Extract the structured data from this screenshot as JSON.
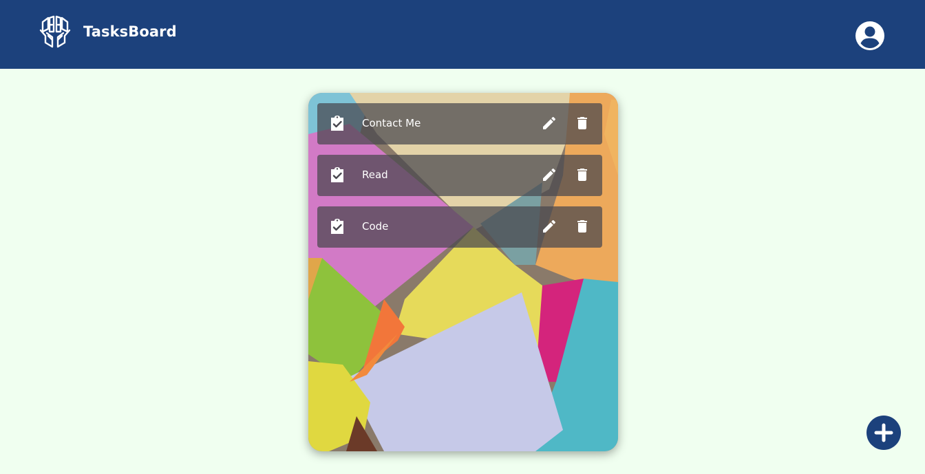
{
  "app": {
    "name": "TasksBoard",
    "logo_icon": "hands-brain-logo-icon"
  },
  "header": {
    "account_icon": "account-circle-icon",
    "background": "#1c417c"
  },
  "board": {
    "background_icon": "sticky-notes-photo",
    "tasks": [
      {
        "label": "Contact Me"
      },
      {
        "label": "Read"
      },
      {
        "label": "Code"
      }
    ]
  },
  "fab": {
    "icon": "plus-icon"
  },
  "colors": {
    "page_bg": "#f0fff0",
    "brand": "#1c417c",
    "task_overlay": "#48464e"
  }
}
